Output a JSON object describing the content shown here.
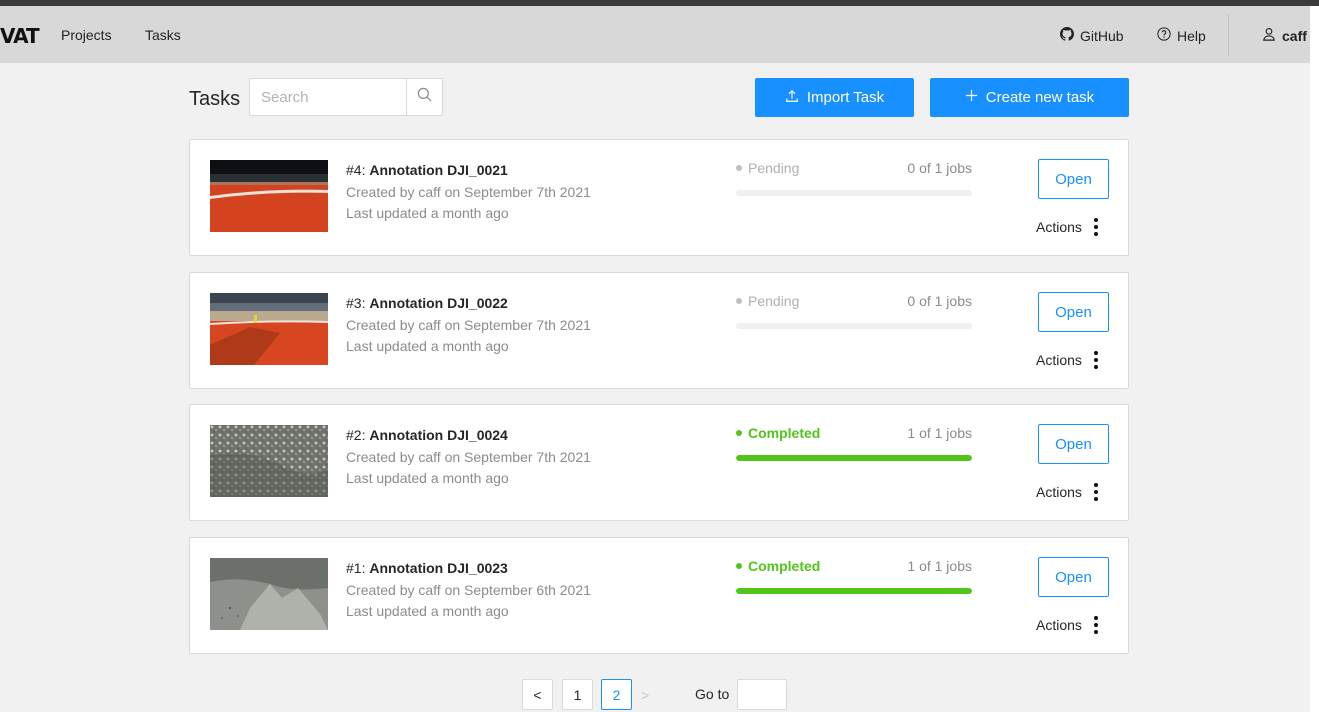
{
  "header": {
    "logo": "VAT",
    "nav": [
      {
        "label": "Projects"
      },
      {
        "label": "Tasks"
      }
    ],
    "github_label": "GitHub",
    "help_label": "Help",
    "user_name": "caff"
  },
  "toolbar": {
    "title": "Tasks",
    "search_placeholder": "Search",
    "import_label": "Import Task",
    "create_label": "Create new task"
  },
  "tasks": [
    {
      "id_prefix": "#4: ",
      "name": "Annotation DJI_0021",
      "created": "Created by caff on September 7th 2021",
      "updated": "Last updated a month ago",
      "status": "Pending",
      "jobs": "0 of 1 jobs",
      "progress": 0,
      "open_label": "Open",
      "actions_label": "Actions",
      "thumb": "runway-dark-sky"
    },
    {
      "id_prefix": "#3: ",
      "name": "Annotation DJI_0022",
      "created": "Created by caff on September 7th 2021",
      "updated": "Last updated a month ago",
      "status": "Pending",
      "jobs": "0 of 1 jobs",
      "progress": 0,
      "open_label": "Open",
      "actions_label": "Actions",
      "thumb": "runway-cloudy"
    },
    {
      "id_prefix": "#2: ",
      "name": "Annotation DJI_0024",
      "created": "Created by caff on September 7th 2021",
      "updated": "Last updated a month ago",
      "status": "Completed",
      "jobs": "1 of 1 jobs",
      "progress": 1,
      "open_label": "Open",
      "actions_label": "Actions",
      "thumb": "aerial-texture"
    },
    {
      "id_prefix": "#1: ",
      "name": "Annotation DJI_0023",
      "created": "Created by caff on September 6th 2021",
      "updated": "Last updated a month ago",
      "status": "Completed",
      "jobs": "1 of 1 jobs",
      "progress": 1,
      "open_label": "Open",
      "actions_label": "Actions",
      "thumb": "aerial-grey"
    }
  ],
  "pagination": {
    "prev_label": "<",
    "pages": [
      "1",
      "2"
    ],
    "current_page": "2",
    "next_label": ">",
    "goto_label": "Go to"
  },
  "colors": {
    "primary": "#1890ff",
    "success": "#52c41a",
    "pending": "#bfbfbf",
    "header_bg": "#d8d8d8",
    "page_bg": "#f1f1f1"
  }
}
